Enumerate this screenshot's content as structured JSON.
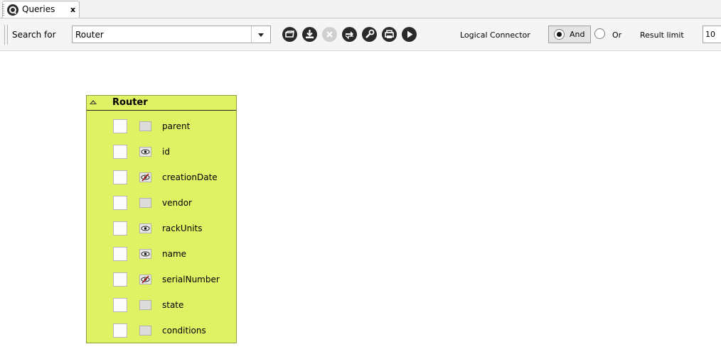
{
  "tab": {
    "label": "Queries",
    "close": "x",
    "icon": "search-icon"
  },
  "toolbar": {
    "search_label": "Search for",
    "search_value": "Router",
    "tools": [
      "open-query-icon",
      "save-query-icon",
      "clear-icon",
      "refresh-icon",
      "settings-icon",
      "print-icon",
      "run-query-icon"
    ],
    "logical_connector_label": "Logical Connector",
    "and_label": "And",
    "or_label": "Or",
    "connector_selected": "And",
    "result_limit_label": "Result limit",
    "result_limit_value": "10"
  },
  "entity": {
    "title": "Router",
    "attributes": [
      {
        "name": "parent",
        "visibility": "none"
      },
      {
        "name": "id",
        "visibility": "visible"
      },
      {
        "name": "creationDate",
        "visibility": "hidden"
      },
      {
        "name": "vendor",
        "visibility": "none"
      },
      {
        "name": "rackUnits",
        "visibility": "visible"
      },
      {
        "name": "name",
        "visibility": "visible"
      },
      {
        "name": "serialNumber",
        "visibility": "hidden"
      },
      {
        "name": "state",
        "visibility": "none"
      },
      {
        "name": "conditions",
        "visibility": "none"
      }
    ]
  },
  "colors": {
    "entity_background": "#dff264",
    "toolbar_background": "#f5f5f5"
  }
}
